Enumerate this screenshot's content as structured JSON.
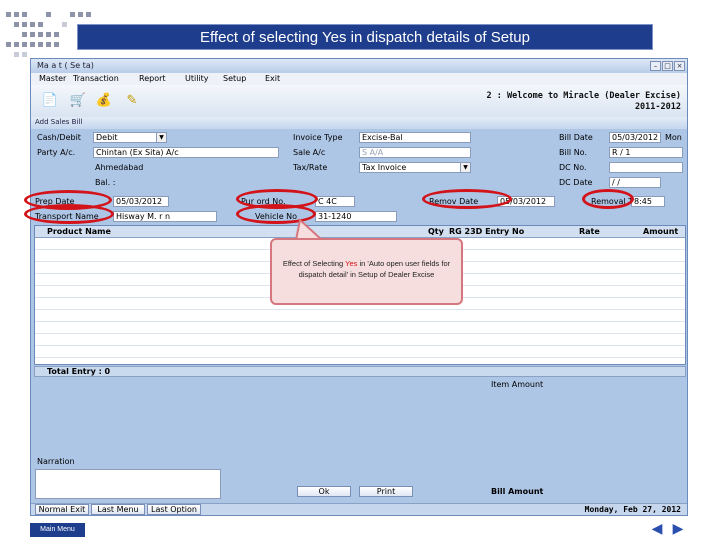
{
  "slide": {
    "title": "Effect of selecting Yes in dispatch details of Setup",
    "main_menu_label": "Main Menu"
  },
  "window": {
    "title": "Ma  a  t   ( Se    ta)"
  },
  "menu": [
    "Master",
    "Transaction",
    "Report",
    "Utility",
    "Setup",
    "Exit"
  ],
  "toolbar": {
    "welcome_line1": "2 : Welcome to Miracle (Dealer Excise)",
    "welcome_line2": "2011-2012"
  },
  "form_title": "Add Sales Bill",
  "form": {
    "cash_debit_label": "Cash/Debit",
    "cash_debit_value": "Debit",
    "party_label": "Party A/c.",
    "party_value": "Chintan (Ex  Sita) A/c",
    "city_value": "Ahmedabad",
    "bal_label": "Bal. :",
    "invoice_type_label": "Invoice Type",
    "invoice_type_value": "Excise-Bal",
    "sale_ac_label": "Sale A/c",
    "sale_ac_value": "S   A/A",
    "tax_label": "Tax/Rate",
    "tax_value": "Tax Invoice",
    "bill_date_label": "Bill Date",
    "bill_date_value": "05/03/2012",
    "bill_date_day": "Mon",
    "bill_no_label": "Bill No.",
    "bill_no_value": "R  / 1",
    "dc_no_label": "DC  No.",
    "dc_date_label": "DC  Date",
    "dc_date_value": "  / /",
    "prep_date_label": "Prep   Date",
    "prep_date_value": "05/03/2012",
    "pur_ord_label": "Pur  ord  No.",
    "pur_ord_value": "C   4C",
    "remove_date_label": "Remov  Date",
    "remove_date_value": "05/03/2012",
    "removal_time_label": "Removal  Time",
    "removal_time_value": "  8:45",
    "transport_label": "Transport  Name",
    "transport_value": "Hisway  M. r   n",
    "vehicle_label": "Vehicle  No",
    "vehicle_value": "  31-1240"
  },
  "grid": {
    "headers": [
      "Product Name",
      "Qty",
      "RG 23D Entry No",
      "Rate",
      "Amount"
    ],
    "total_label": "Total Entry : 0"
  },
  "footer": {
    "item_amount_label": "Item Amount",
    "narration_label": "Narration",
    "ok_label": "Ok",
    "print_label": "Print",
    "bill_amount_label": "Bill Amount",
    "normal_exit_label": "Normal Exit",
    "last_menu_label": "Last Menu",
    "last_option_label": "Last Option",
    "status_date": "Monday, Feb 27, 2012"
  },
  "callout": {
    "text_before": "Effect of Selecting",
    "text_yes": "Yes",
    "text_after": "in 'Auto open user fields for dispatch detail' in Setup of Dealer Excise"
  },
  "colors": {
    "title_bar": "#1e3d8c",
    "highlight_red": "#d2141a",
    "app_bg": "#aec6e6"
  }
}
